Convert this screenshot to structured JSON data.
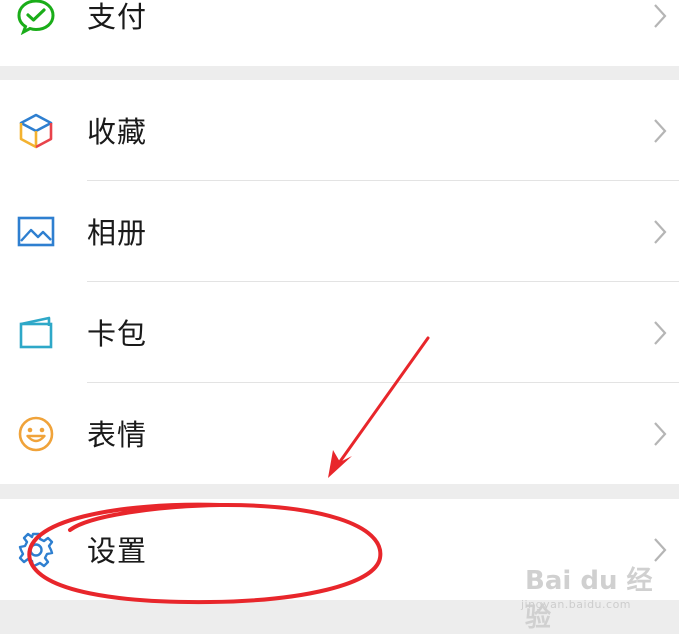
{
  "menu": {
    "pay": {
      "label": "支付",
      "icon": "wechat-pay-icon"
    },
    "favorites": {
      "label": "收藏",
      "icon": "cube-icon"
    },
    "album": {
      "label": "相册",
      "icon": "picture-icon"
    },
    "cards": {
      "label": "卡包",
      "icon": "wallet-card-icon"
    },
    "stickers": {
      "label": "表情",
      "icon": "smiley-icon"
    },
    "settings": {
      "label": "设置",
      "icon": "gear-icon"
    }
  },
  "colors": {
    "background": "#ededed",
    "pay_green": "#1aad19",
    "album_blue": "#2e7fd0",
    "sticker_orange": "#f0a33a",
    "annotation_red": "#e8262b"
  },
  "watermark": {
    "brand": "Bai du 经验",
    "url": "jingyan.baidu.com"
  }
}
